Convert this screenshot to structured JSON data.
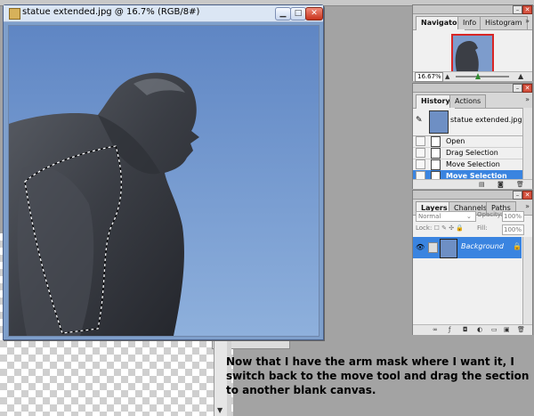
{
  "document": {
    "title": "statue extended.jpg @ 16.7% (RGB/8#)"
  },
  "navigator_panel": {
    "tabs": [
      "Navigator",
      "Info",
      "Histogram"
    ],
    "zoom": "16.67%"
  },
  "history_panel": {
    "tabs": [
      "History",
      "Actions"
    ],
    "snapshot": "statue extended.jpg",
    "states": [
      "Open",
      "Drag Selection",
      "Move Selection",
      "Move Selection"
    ],
    "selected_index": 3
  },
  "layers_panel": {
    "tabs": [
      "Layers",
      "Channels",
      "Paths"
    ],
    "blend_mode": "Normal",
    "opacity_label": "Opacity:",
    "opacity": "100%",
    "lock_label": "Lock:",
    "fill_label": "Fill:",
    "fill": "100%",
    "layer_name": "Background"
  },
  "caption": "Now that I have the arm mask where I want it, I switch back to the move tool and drag the section to another blank canvas.",
  "colors": {
    "selection": "#3a84e0",
    "sky": "#7e9fcb",
    "workspace": "#a3a3a3"
  }
}
